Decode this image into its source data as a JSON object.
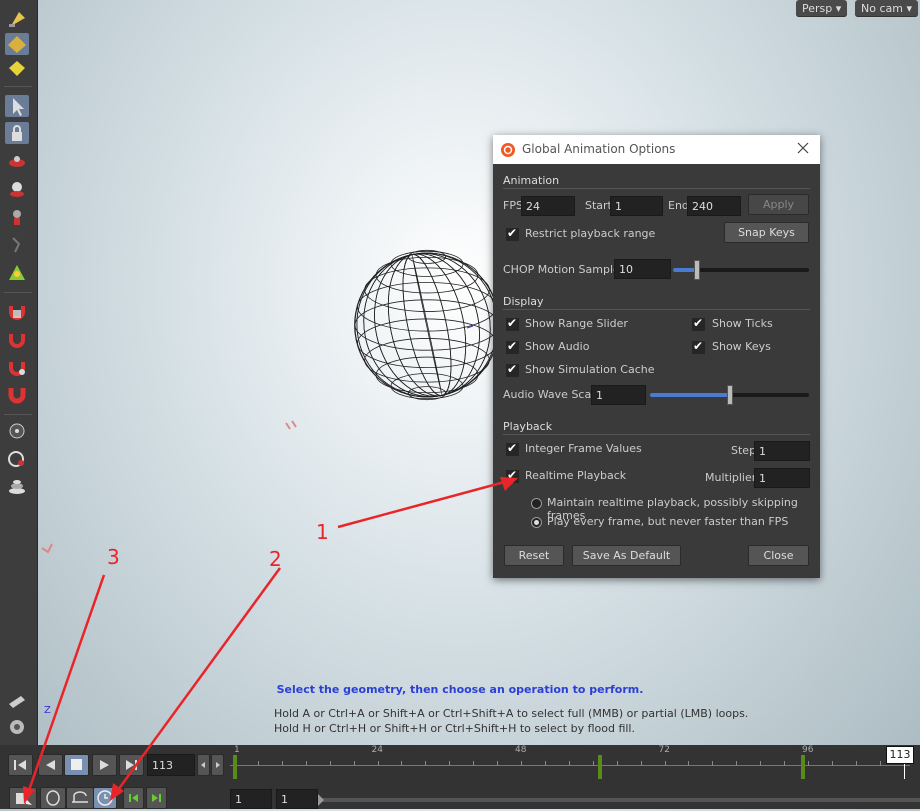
{
  "viewport": {
    "persp_label": "Persp",
    "cam_label": "No cam",
    "axis_label": "Z",
    "hint_title": "Select the geometry, then choose an operation to perform.",
    "hint_line1": "Hold A or Ctrl+A or Shift+A or Ctrl+Shift+A to select full (MMB) or partial (LMB) loops.",
    "hint_line2": "Hold H or Ctrl+H or Shift+H or Ctrl+Shift+H to select by flood fill."
  },
  "toolbar": {
    "items": [
      "wand-icon",
      "move-icon",
      "edit-icon",
      "select-icon",
      "lock-icon",
      "handle-icon",
      "light-icon",
      "paint-icon",
      "bone-icon",
      "pose-icon",
      "magnet-icon",
      "curve-icon",
      "magnet2-icon",
      "magnet3-icon",
      "snap-icon",
      "circle-snap-icon",
      "stack-icon",
      "render-icon",
      "gear-icon"
    ]
  },
  "dialog": {
    "title": "Global Animation Options",
    "sections": {
      "animation": "Animation",
      "display": "Display",
      "playback": "Playback"
    },
    "fps_label": "FPS",
    "fps_value": "24",
    "start_label": "Start",
    "start_value": "1",
    "end_label": "End",
    "end_value": "240",
    "apply_label": "Apply",
    "restrict_label": "Restrict playback range",
    "snap_keys_label": "Snap Keys",
    "chop_label": "CHOP Motion Samples",
    "chop_value": "10",
    "chop_fraction": 0.18,
    "show_range_slider": "Show Range Slider",
    "show_ticks": "Show Ticks",
    "show_audio": "Show Audio",
    "show_keys": "Show Keys",
    "show_sim_cache": "Show Simulation Cache",
    "audio_wave_label": "Audio Wave Scale",
    "audio_wave_value": "1",
    "audio_wave_fraction": 0.5,
    "integer_frames": "Integer Frame Values",
    "step_label": "Step",
    "step_value": "1",
    "realtime_label": "Realtime Playback",
    "multiplier_label": "Multiplier",
    "multiplier_value": "1",
    "radio1": "Maintain realtime playback, possibly skipping frames",
    "radio2": "Play every frame, but never faster than FPS",
    "reset_label": "Reset",
    "save_default_label": "Save As Default",
    "close_label": "Close"
  },
  "timeline": {
    "current_frame": "113",
    "frame_badge": "113",
    "ruler_labels": [
      "1",
      "24",
      "48",
      "72",
      "96"
    ],
    "range_start": "1",
    "range_end": "1"
  },
  "annotations": {
    "a1": "1",
    "a2": "2",
    "a3": "3"
  },
  "colors": {
    "annotation_red": "#e8262a",
    "hint_blue": "#2a3fd6",
    "key_green": "#5a8a1a"
  }
}
